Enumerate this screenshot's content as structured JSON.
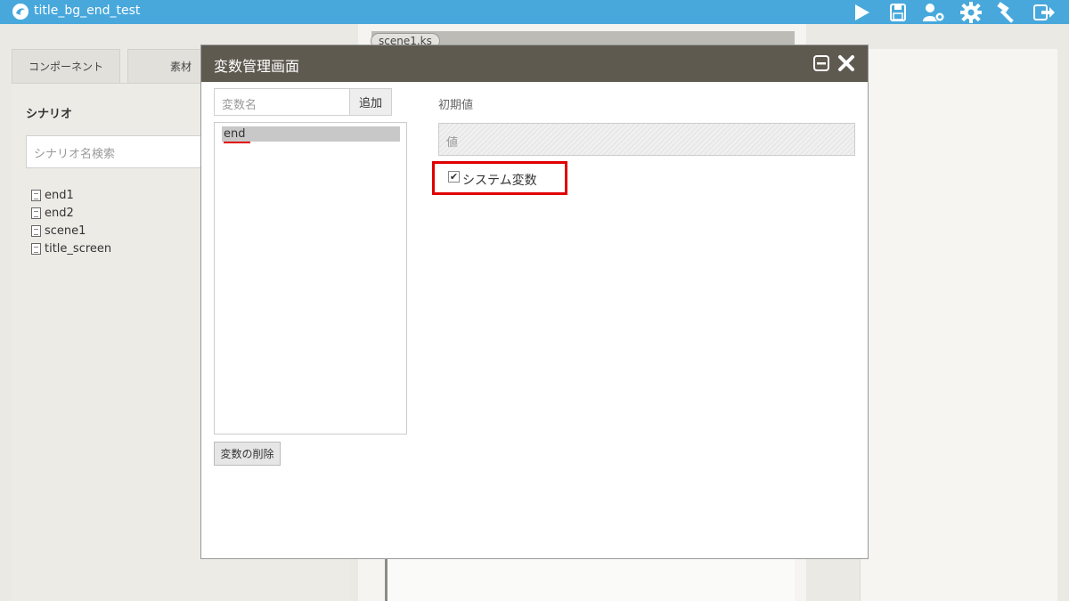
{
  "app": {
    "project_title": "title_bg_end_test"
  },
  "toolbar": {
    "icons": [
      "play-icon",
      "save-icon",
      "user-settings-icon",
      "gear-icon",
      "hammer-icon",
      "exit-icon"
    ]
  },
  "left_panel": {
    "tabs": [
      "コンポーネント",
      "素材"
    ],
    "heading": "シナリオ",
    "search_placeholder": "シナリオ名検索",
    "files": [
      "end1",
      "end2",
      "scene1",
      "title_screen"
    ]
  },
  "editor": {
    "file_tab": "scene1.ks"
  },
  "dialog": {
    "title": "変数管理画面",
    "var_name_placeholder": "変数名",
    "add_label": "追加",
    "variables": [
      "end"
    ],
    "delete_label": "変数の削除",
    "initial_value_label": "初期値",
    "value_placeholder": "値",
    "system_var_label": "システム変数",
    "system_var_checked": true
  },
  "colors": {
    "topbar": "#48a8dc",
    "dialog_header": "#5f5a50",
    "highlight": "#e00000"
  }
}
